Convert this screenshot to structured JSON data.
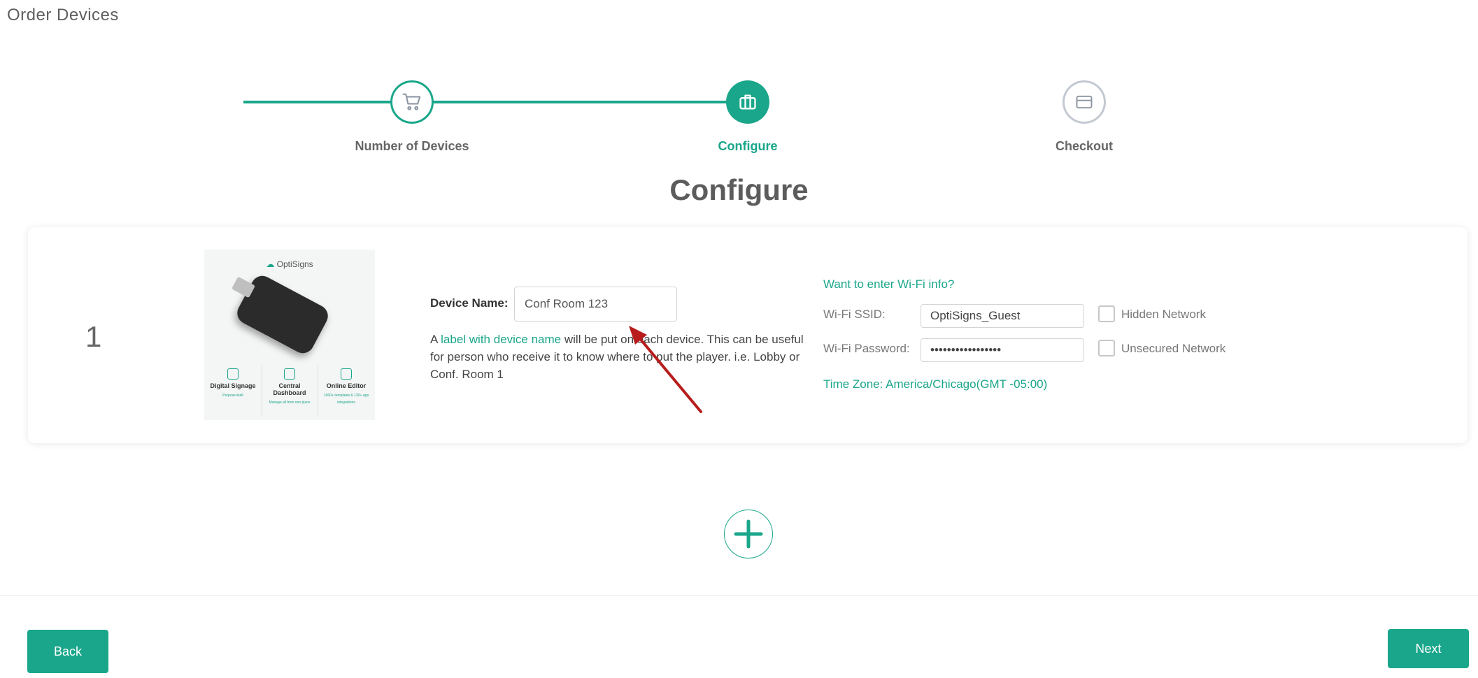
{
  "header": {
    "title": "Order Devices"
  },
  "stepper": {
    "steps": [
      {
        "label": "Number of Devices",
        "icon": "cart-icon",
        "state": "done"
      },
      {
        "label": "Configure",
        "icon": "briefcase-icon",
        "state": "active"
      },
      {
        "label": "Checkout",
        "icon": "credit-card-icon",
        "state": "todo"
      }
    ]
  },
  "section": {
    "title": "Configure"
  },
  "device": {
    "index": "1",
    "image": {
      "brand": "OptiSigns",
      "features": [
        {
          "title": "Digital Signage",
          "subtitle": "Purpose-built"
        },
        {
          "title": "Central Dashboard",
          "subtitle": "Manage all from one place"
        },
        {
          "title": "Online Editor",
          "subtitle": "1000+ templates & 130+ app integrations"
        }
      ]
    },
    "name_label": "Device Name:",
    "name_value": "Conf Room 123",
    "help": {
      "prefix": "A",
      "link": "label with device name",
      "suffix": "will be put on each device. This can be useful for person who receive it to know where to put the player. i.e. Lobby or Conf. Room 1"
    }
  },
  "wifi": {
    "question": "Want to enter Wi-Fi info?",
    "ssid_label": "Wi-Fi SSID:",
    "ssid_value": "OptiSigns_Guest",
    "password_label": "Wi-Fi Password:",
    "password_value": "•••••••••••••••••",
    "hidden_label": "Hidden Network",
    "unsecured_label": "Unsecured Network",
    "timezone": "Time Zone: America/Chicago(GMT -05:00)"
  },
  "footer": {
    "back_label": "Back",
    "next_label": "Next"
  },
  "colors": {
    "accent": "#1aa68a",
    "annotation_arrow": "#b81c1c"
  }
}
